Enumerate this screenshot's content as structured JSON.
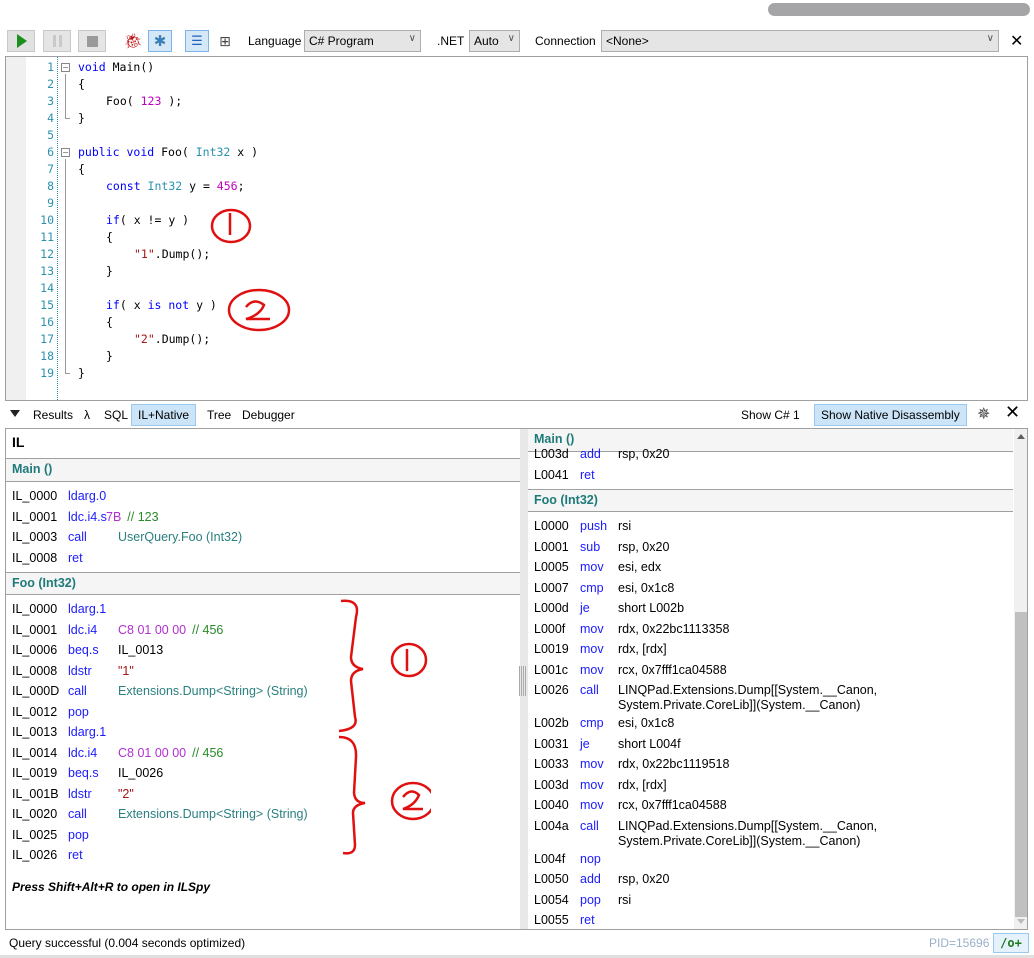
{
  "toolbar": {
    "language_label": "Language",
    "language_value": "C# Program",
    "dotnet_label": ".NET",
    "dotnet_value": "Auto",
    "connection_label": "Connection",
    "connection_value": "<None>",
    "icons": {
      "run": "play-icon",
      "pause": "pause-icon",
      "stop": "stop-icon",
      "bug": "bug-icon",
      "bug_one": "bug-one-icon",
      "results_text": "list-view-icon",
      "results_grid": "grid-view-icon",
      "close": "close-icon"
    }
  },
  "editor": {
    "lines": [
      {
        "n": "1"
      },
      {
        "n": "2"
      },
      {
        "n": "3"
      },
      {
        "n": "4"
      },
      {
        "n": "5"
      },
      {
        "n": "6"
      },
      {
        "n": "7"
      },
      {
        "n": "8"
      },
      {
        "n": "9"
      },
      {
        "n": "10"
      },
      {
        "n": "11"
      },
      {
        "n": "12"
      },
      {
        "n": "13"
      },
      {
        "n": "14"
      },
      {
        "n": "15"
      },
      {
        "n": "16"
      },
      {
        "n": "17"
      },
      {
        "n": "18"
      },
      {
        "n": "19"
      }
    ],
    "tokens": {
      "void": "void",
      "main": " Main()",
      "brace_open": "{",
      "brace_close": "}",
      "foo_call": "Foo( ",
      "n123": "123",
      "foo_call_end": " );",
      "public": "public",
      "void2": " void",
      "foo_decl": " Foo( ",
      "int32": "Int32",
      "x_close": " x )",
      "const": "const",
      "int32b": " Int32",
      "y_eq": " y = ",
      "n456": "456",
      "semi": ";",
      "if1": "if",
      "cond1": "( x != y )",
      "str1": "\"1\"",
      "dump": ".Dump();",
      "if2": "if",
      "paren2": "( x ",
      "is": "is",
      "not": "not",
      "y2": " y )",
      "str2": "\"2\""
    },
    "annotations": [
      "1",
      "2"
    ]
  },
  "results_tabs": {
    "items": [
      {
        "label": "Results"
      },
      {
        "label": "λ"
      },
      {
        "label": "SQL"
      },
      {
        "label": "IL+Native",
        "active": true
      },
      {
        "label": "Tree"
      },
      {
        "label": "Debugger"
      }
    ],
    "show_csharp": "Show C# 1",
    "show_native": "Show Native Disassembly"
  },
  "il": {
    "title": "IL",
    "sections": [
      {
        "header": "Main ()",
        "rows": [
          {
            "addr": "IL_0000",
            "op": "ldarg.0",
            "arg": ""
          },
          {
            "addr": "IL_0001",
            "op": "ldc.i4.s",
            "arg": "7B",
            "comment": "// 123"
          },
          {
            "addr": "IL_0003",
            "op": "call",
            "arg": "UserQuery.Foo (Int32)"
          },
          {
            "addr": "IL_0008",
            "op": "ret",
            "arg": ""
          }
        ]
      },
      {
        "header": "Foo (Int32)",
        "rows": [
          {
            "addr": "IL_0000",
            "op": "ldarg.1",
            "arg": ""
          },
          {
            "addr": "IL_0001",
            "op": "ldc.i4",
            "arg": "C8 01 00 00",
            "comment": "// 456"
          },
          {
            "addr": "IL_0006",
            "op": "beq.s",
            "arg": "IL_0013"
          },
          {
            "addr": "IL_0008",
            "op": "ldstr",
            "arg": "\"1\""
          },
          {
            "addr": "IL_000D",
            "op": "call",
            "arg": "Extensions.Dump<String> (String)"
          },
          {
            "addr": "IL_0012",
            "op": "pop",
            "arg": ""
          },
          {
            "addr": "IL_0013",
            "op": "ldarg.1",
            "arg": ""
          },
          {
            "addr": "IL_0014",
            "op": "ldc.i4",
            "arg": "C8 01 00 00",
            "comment": "// 456"
          },
          {
            "addr": "IL_0019",
            "op": "beq.s",
            "arg": "IL_0026"
          },
          {
            "addr": "IL_001B",
            "op": "ldstr",
            "arg": "\"2\""
          },
          {
            "addr": "IL_0020",
            "op": "call",
            "arg": "Extensions.Dump<String> (String)"
          },
          {
            "addr": "IL_0025",
            "op": "pop",
            "arg": ""
          },
          {
            "addr": "IL_0026",
            "op": "ret",
            "arg": ""
          }
        ]
      }
    ],
    "hint": "Press Shift+Alt+R to open in ILSpy",
    "annotations": [
      "1",
      "2"
    ]
  },
  "native": {
    "sections": [
      {
        "header": "Main ()",
        "rows": [
          {
            "addr": "L003d",
            "op": "add",
            "arg": "rsp, 0x20"
          },
          {
            "addr": "L0041",
            "op": "ret",
            "arg": ""
          }
        ]
      },
      {
        "header": "Foo (Int32)",
        "rows": [
          {
            "addr": "L0000",
            "op": "push",
            "arg": "rsi"
          },
          {
            "addr": "L0001",
            "op": "sub",
            "arg": "rsp, 0x20"
          },
          {
            "addr": "L0005",
            "op": "mov",
            "arg": "esi, edx"
          },
          {
            "addr": "L0007",
            "op": "cmp",
            "arg": "esi, 0x1c8"
          },
          {
            "addr": "L000d",
            "op": "je",
            "arg": "short L002b"
          },
          {
            "addr": "L000f",
            "op": "mov",
            "arg": "rdx, 0x22bc1113358"
          },
          {
            "addr": "L0019",
            "op": "mov",
            "arg": "rdx, [rdx]"
          },
          {
            "addr": "L001c",
            "op": "mov",
            "arg": "rcx, 0x7fff1ca04588"
          },
          {
            "addr": "L0026",
            "op": "call",
            "arg": "LINQPad.Extensions.Dump[[System.__Canon,\nSystem.Private.CoreLib]](System.__Canon)"
          },
          {
            "addr": "L002b",
            "op": "cmp",
            "arg": "esi, 0x1c8"
          },
          {
            "addr": "L0031",
            "op": "je",
            "arg": "short L004f"
          },
          {
            "addr": "L0033",
            "op": "mov",
            "arg": "rdx, 0x22bc1119518"
          },
          {
            "addr": "L003d",
            "op": "mov",
            "arg": "rdx, [rdx]"
          },
          {
            "addr": "L0040",
            "op": "mov",
            "arg": "rcx, 0x7fff1ca04588"
          },
          {
            "addr": "L004a",
            "op": "call",
            "arg": "LINQPad.Extensions.Dump[[System.__Canon,\nSystem.Private.CoreLib]](System.__Canon)"
          },
          {
            "addr": "L004f",
            "op": "nop",
            "arg": ""
          },
          {
            "addr": "L0050",
            "op": "add",
            "arg": "rsp, 0x20"
          },
          {
            "addr": "L0054",
            "op": "pop",
            "arg": "rsi"
          },
          {
            "addr": "L0055",
            "op": "ret",
            "arg": ""
          }
        ]
      }
    ]
  },
  "status": {
    "text": "Query successful  (0.004 seconds optimized)",
    "pid": "PID=15696",
    "optimize": "/o+"
  }
}
